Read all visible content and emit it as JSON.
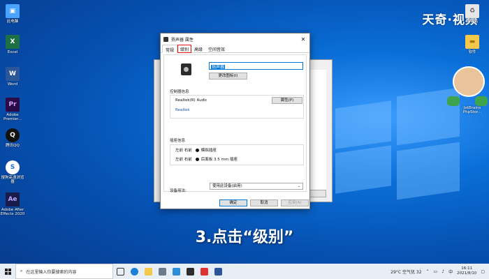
{
  "watermark": "天奇·视频",
  "desktop_icons": [
    {
      "label": "此电脑",
      "glyph": "▣",
      "color": "#4aa3ff"
    },
    {
      "label": "Excel",
      "glyph": "X",
      "color": "#1d7044"
    },
    {
      "label": "Word",
      "glyph": "W",
      "color": "#2b579a"
    },
    {
      "label": "Adobe Premier...",
      "glyph": "Pr",
      "color": "#2a0a47"
    },
    {
      "label": "腾讯QQ",
      "glyph": "Q",
      "color": "#111111"
    },
    {
      "label": "搜狗高速浏览器",
      "glyph": "S",
      "color": "#1a6fd8"
    },
    {
      "label": "Adobe After Effects 2020",
      "glyph": "Ae",
      "color": "#1a1a4a"
    }
  ],
  "right_icons": [
    {
      "label": "回收站"
    },
    {
      "label": "软件"
    },
    {
      "label": "JetBrains PhpStor..."
    }
  ],
  "dialog": {
    "title": "扬声器 属性",
    "close": "✕",
    "tabs": [
      "常规",
      "级别",
      "高级",
      "空间音效"
    ],
    "active_tab": "常规",
    "highlight_tab": "级别",
    "name_value": "扬声器",
    "change_icon_btn": "更改图标(I)",
    "controller_label": "控制器信息",
    "controller_name": "Realtek(R) Audio",
    "controller_link": "Realtek",
    "properties_btn": "属性(P)",
    "jack_label": "插座信息",
    "jacks": [
      {
        "pos": "左前 右前",
        "desc": "模拟插座"
      },
      {
        "pos": "左前 右前",
        "desc": "后面板 3.5 mm 插座"
      }
    ],
    "device_usage_label": "设备用法:",
    "device_usage_value": "使用此设备(启用)",
    "ok_btn": "确定",
    "cancel_btn": "取消",
    "apply_btn": "应用(A)"
  },
  "caption": "3.点击“级别”",
  "taskbar": {
    "search_placeholder": "在这里输入你要搜索的内容",
    "weather": "29°C 空气优 32",
    "ime": "中",
    "time": "16:11",
    "date": "2021/8/10"
  }
}
